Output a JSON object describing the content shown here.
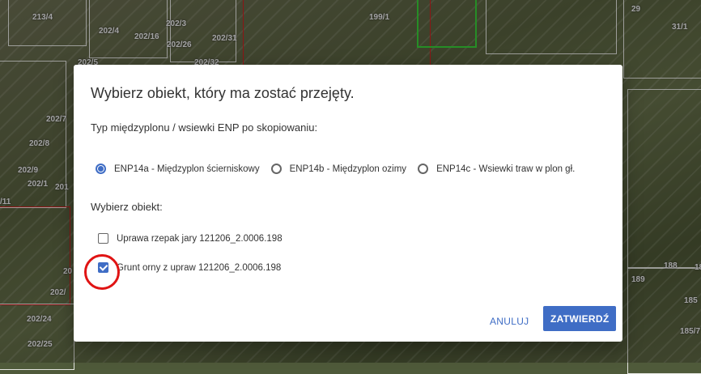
{
  "map": {
    "labels": [
      "213/4",
      "202/3",
      "202/4",
      "202/16",
      "202/26",
      "202/31",
      "199/1",
      "29",
      "31/1",
      "202/5",
      "202/32",
      "202/7",
      "202/8",
      "202/9",
      "202/1",
      "201",
      "/11",
      "20",
      "202/",
      "202/24",
      "202/25",
      "188",
      "18",
      "189",
      "185",
      "185/7"
    ]
  },
  "dialog": {
    "title": "Wybierz obiekt, który ma zostać przejęty.",
    "subtitle": "Typ międzyplonu / wsiewki ENP po skopiowaniu:",
    "radios": [
      {
        "label": "ENP14a - Międzyplon ścierniskowy",
        "selected": true
      },
      {
        "label": "ENP14b - Międzyplon ozimy",
        "selected": false
      },
      {
        "label": "ENP14c - Wsiewki traw w plon gł.",
        "selected": false
      }
    ],
    "section_label": "Wybierz obiekt:",
    "objects": [
      {
        "label": "Uprawa rzepak jary 121206_2.0006.198",
        "checked": false
      },
      {
        "label": "Grunt orny z upraw 121206_2.0006.198",
        "checked": true
      }
    ],
    "cancel_label": "ANULUJ",
    "confirm_label": "ZATWIERDŹ"
  },
  "colors": {
    "accent": "#3f6dc5",
    "annotation": "#e01414"
  }
}
